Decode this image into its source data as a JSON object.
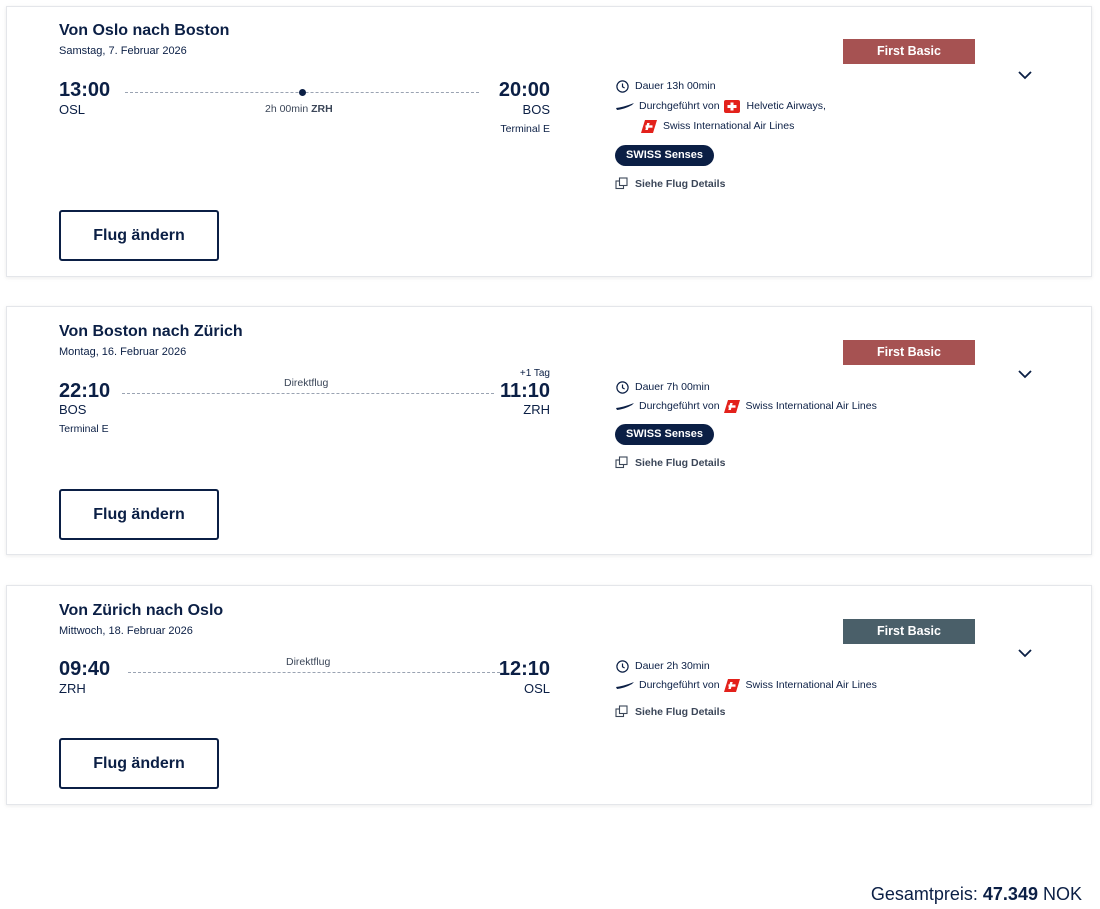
{
  "flights": [
    {
      "title": "Von Oslo nach Boston",
      "date": "Samstag, 7. Februar 2026",
      "dep_time": "13:00",
      "dep_code": "OSL",
      "dep_terminal": "",
      "arr_time": "20:00",
      "arr_code": "BOS",
      "arr_terminal": "Terminal E",
      "plus_day": "",
      "stop_duration": "2h 00min",
      "stop_airport": "ZRH",
      "direct_label": "",
      "duration": "Dauer 13h 00min",
      "operated_by": "Durchgeführt von",
      "carrier_1": "Helvetic Airways,",
      "carrier_2": "Swiss International Air Lines",
      "senses": "SWISS Senses",
      "details": "Siehe Flug Details",
      "fare": "First Basic",
      "fare_color": "#a65252",
      "change_button": "Flug ändern"
    },
    {
      "title": "Von Boston nach Zürich",
      "date": "Montag, 16. Februar 2026",
      "dep_time": "22:10",
      "dep_code": "BOS",
      "dep_terminal": "Terminal E",
      "arr_time": "11:10",
      "arr_code": "ZRH",
      "arr_terminal": "",
      "plus_day": "+1 Tag",
      "direct_label": "Direktflug",
      "duration": "Dauer 7h 00min",
      "operated_by": "Durchgeführt von",
      "carrier_1": "Swiss International Air Lines",
      "senses": "SWISS Senses",
      "details": "Siehe Flug Details",
      "fare": "First Basic",
      "fare_color": "#a65252",
      "change_button": "Flug ändern"
    },
    {
      "title": "Von Zürich nach Oslo",
      "date": "Mittwoch, 18. Februar 2026",
      "dep_time": "09:40",
      "dep_code": "ZRH",
      "dep_terminal": "",
      "arr_time": "12:10",
      "arr_code": "OSL",
      "arr_terminal": "",
      "plus_day": "",
      "direct_label": "Direktflug",
      "duration": "Dauer 2h 30min",
      "operated_by": "Durchgeführt von",
      "carrier_1": "Swiss International Air Lines",
      "details": "Siehe Flug Details",
      "fare": "First Basic",
      "fare_color": "#4a5f69",
      "change_button": "Flug ändern"
    }
  ],
  "total": {
    "label": "Gesamtpreis:",
    "amount": "47.349",
    "currency": "NOK"
  },
  "colors": {
    "navy": "#0b1f45",
    "swiss_red": "#e3211b"
  },
  "icons": [
    "clock-icon",
    "plane-icon",
    "swiss-flag-icon",
    "helvetic-flag-icon",
    "external-details-icon",
    "chevron-down-icon"
  ]
}
